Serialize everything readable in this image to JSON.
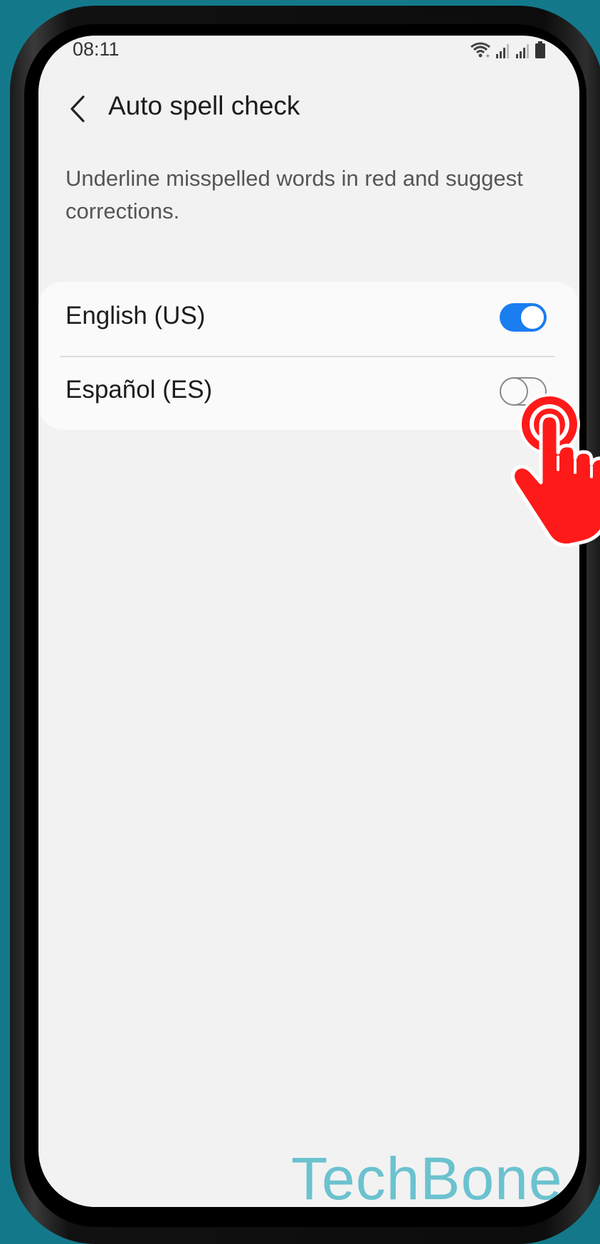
{
  "status_bar": {
    "time": "08:11",
    "icons": [
      "wifi-icon",
      "signal-icon",
      "signal-icon",
      "battery-icon"
    ]
  },
  "app_bar": {
    "back_icon": "chevron-left-icon",
    "title": "Auto spell check"
  },
  "description": "Underline misspelled words in red and suggest corrections.",
  "languages": [
    {
      "label": "English (US)",
      "enabled": true
    },
    {
      "label": "Español (ES)",
      "enabled": false
    }
  ],
  "watermark": "TechBone",
  "colors": {
    "accent": "#1a7df0",
    "tap_indicator": "#ff1a1a",
    "watermark": "#6bc2cf",
    "background": "#13798a"
  }
}
